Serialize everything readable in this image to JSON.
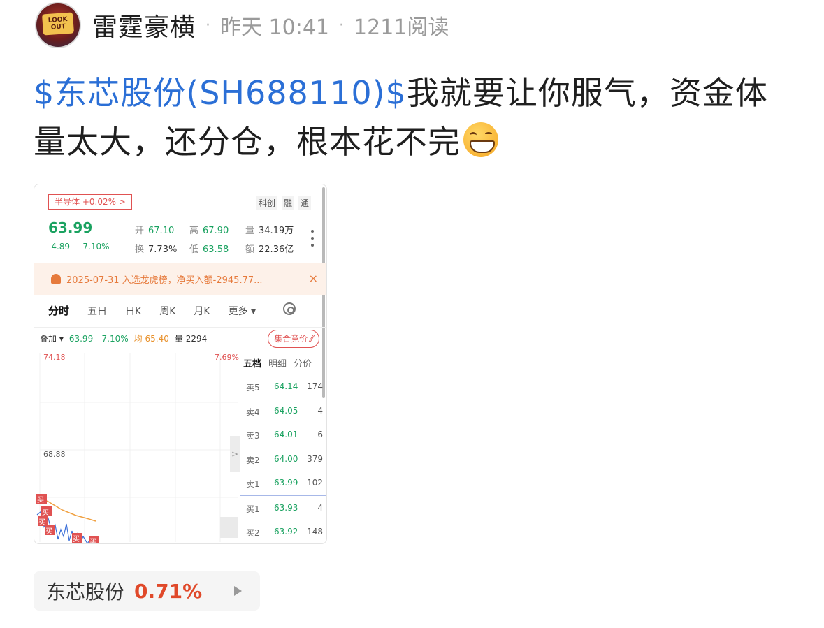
{
  "header": {
    "avatar_text": [
      "LOOK",
      "OUT"
    ],
    "author": "雷霆豪横",
    "time": "昨天 10:41",
    "reads": "1211阅读",
    "sep": "·"
  },
  "post": {
    "tag": "$东芯股份(SH688110)$",
    "text": "我就要让你服气，资金体量太大，还分仓，根本花不完",
    "emoji": "grinning-face-emoji"
  },
  "screenshot": {
    "sector": "半导体 +0.02% >",
    "flags": [
      "科创",
      "融",
      "通"
    ],
    "price": "63.99",
    "change_abs": "-4.89",
    "change_pct": "-7.10%",
    "stats": {
      "open_label": "开",
      "open": "67.10",
      "high_label": "高",
      "high": "67.90",
      "vol_label": "量",
      "vol": "34.19万",
      "turnover_label": "换",
      "turnover": "7.73%",
      "low_label": "低",
      "low": "63.58",
      "amount_label": "额",
      "amount": "22.36亿"
    },
    "notice": "2025-07-31 入选龙虎榜，净买入额-2945.77...",
    "notice_close": "×",
    "tabs": [
      "分时",
      "五日",
      "日K",
      "周K",
      "月K",
      "更多 ▾"
    ],
    "overlay": {
      "label": "叠加 ▾",
      "price": "63.99",
      "pct": "-7.10%",
      "avg_label": "均",
      "avg": "65.40",
      "vol_label": "量",
      "vol": "2294"
    },
    "auction_button": "集合竞价 ⁄⁄",
    "axis": {
      "top_left": "74.18",
      "top_right": "7.69%",
      "mid_left": "68.88"
    },
    "sidetab": ">",
    "markers": [
      "买",
      "买",
      "买",
      "买",
      "买",
      "买"
    ],
    "book_tabs": [
      "五档",
      "明细",
      "分价"
    ],
    "book": [
      {
        "label": "卖5",
        "price": "64.14",
        "vol": "174"
      },
      {
        "label": "卖4",
        "price": "64.05",
        "vol": "4"
      },
      {
        "label": "卖3",
        "price": "64.01",
        "vol": "6"
      },
      {
        "label": "卖2",
        "price": "64.00",
        "vol": "379"
      },
      {
        "label": "卖1",
        "price": "63.99",
        "vol": "102"
      },
      {
        "label": "买1",
        "price": "63.93",
        "vol": "4"
      },
      {
        "label": "买2",
        "price": "63.92",
        "vol": "148"
      }
    ],
    "colors": {
      "down": "#1aa260",
      "up": "#e05252",
      "avg_line": "#f0a040",
      "price_line": "#3b6fd8"
    }
  },
  "chip": {
    "name": "东芯股份",
    "pct": "0.71%"
  }
}
